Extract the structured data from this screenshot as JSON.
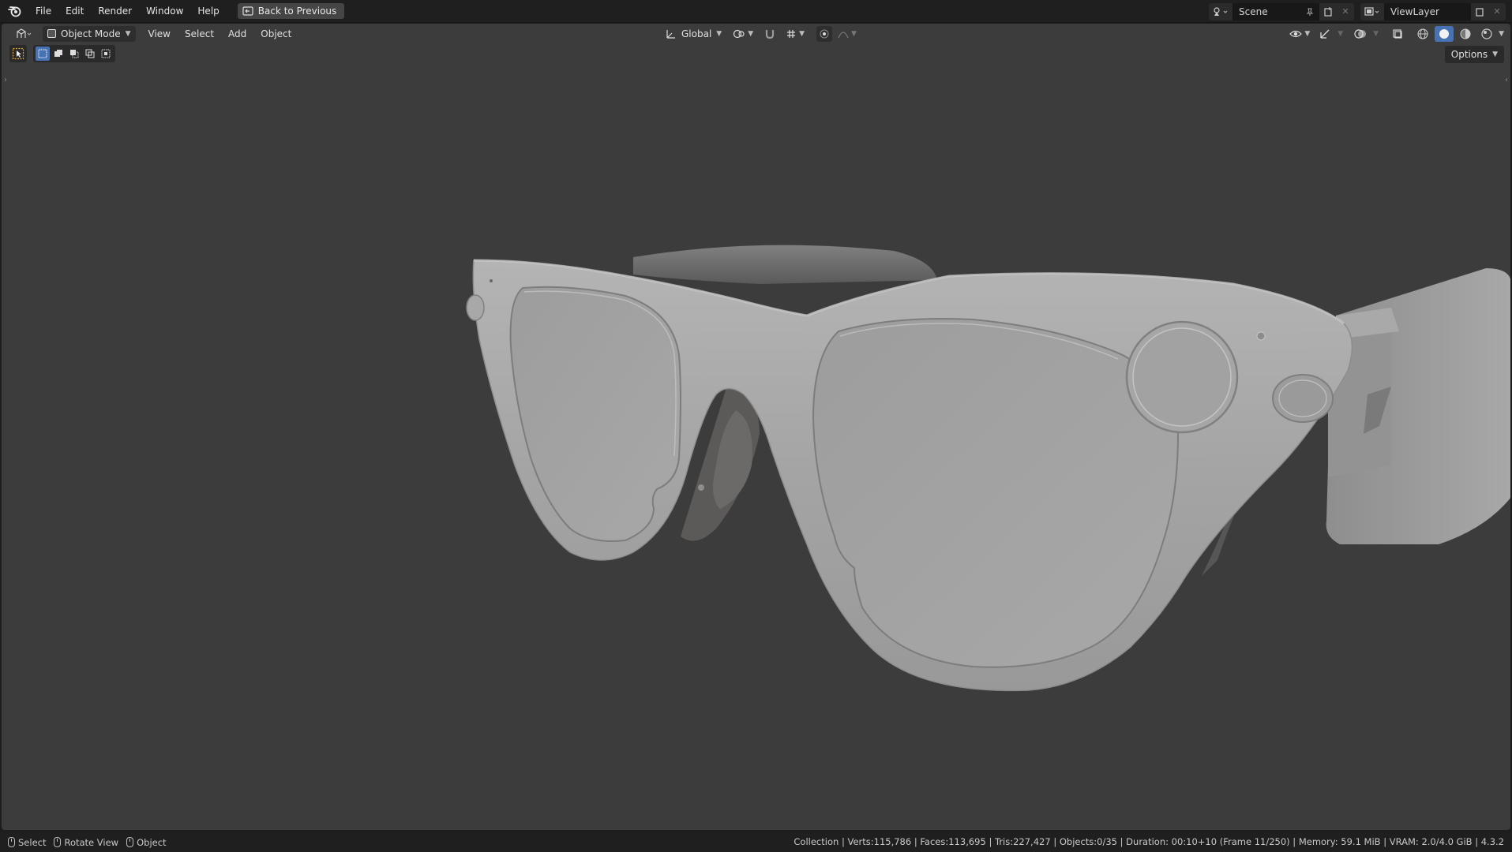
{
  "menu": {
    "items": [
      "File",
      "Edit",
      "Render",
      "Window",
      "Help"
    ],
    "back_label": "Back to Previous"
  },
  "top_right": {
    "scene_name": "Scene",
    "view_layer": "ViewLayer"
  },
  "header3d": {
    "mode": "Object Mode",
    "menus": [
      "View",
      "Select",
      "Add",
      "Object"
    ],
    "orientation": "Global",
    "options_label": "Options"
  },
  "statusbar": {
    "hints": [
      "Select",
      "Rotate View",
      "Object"
    ],
    "stats": "Collection | Verts:115,786 | Faces:113,695 | Tris:227,427 | Objects:0/35 | Duration: 00:10+10 (Frame 11/250) | Memory: 59.1 MiB | VRAM: 2.0/4.0 GiB | 4.3.2"
  },
  "icons": {
    "logo": "blender-logo-icon",
    "back": "back-to-previous-icon",
    "editor_type": "3d-viewport-icon",
    "scene": "scene-icon",
    "view_layer": "view-layer-icon",
    "shading": [
      "wireframe-icon",
      "solid-icon",
      "material-preview-icon",
      "rendered-icon"
    ]
  },
  "colors": {
    "viewport_bg": "#3c3c3c",
    "selection_blue": "#4772b3",
    "model_gray": "#a3a3a3"
  }
}
